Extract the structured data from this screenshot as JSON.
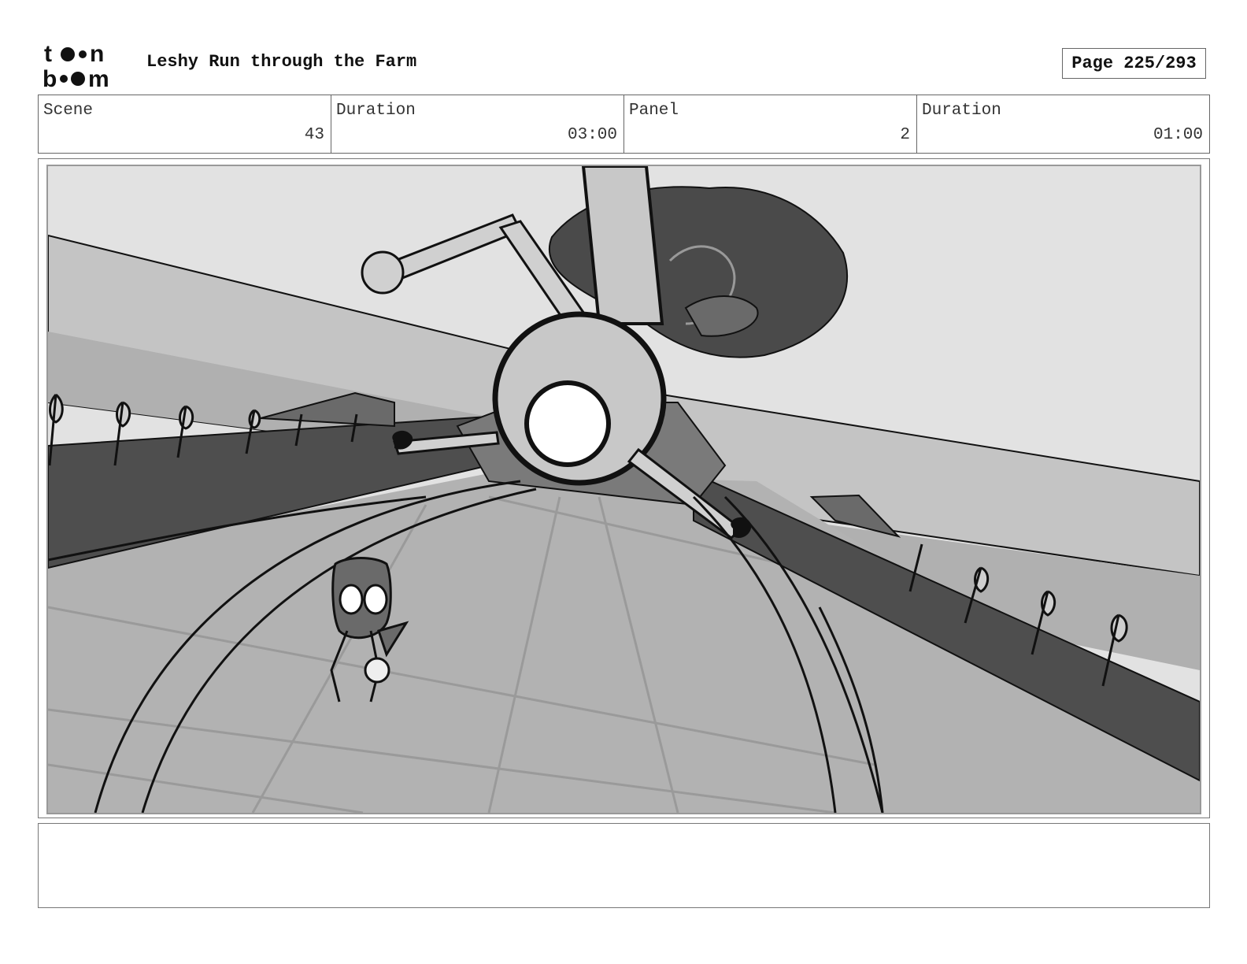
{
  "header": {
    "logo_text_top": "toon",
    "logo_text_bottom": "boom",
    "title": "Leshy Run through the Farm",
    "page_label": "Page 225/293"
  },
  "info": {
    "scene_label": "Scene",
    "scene_value": "43",
    "scene_duration_label": "Duration",
    "scene_duration_value": "03:00",
    "panel_label": "Panel",
    "panel_value": "2",
    "panel_duration_label": "Duration",
    "panel_duration_value": "01:00"
  },
  "notes": {
    "text": ""
  },
  "colors": {
    "sky": "#e2e2e2",
    "ground": "#b2b2b2",
    "dark_strip": "#4e4e4e",
    "wall": "#c4c4c4",
    "line": "#111111"
  }
}
